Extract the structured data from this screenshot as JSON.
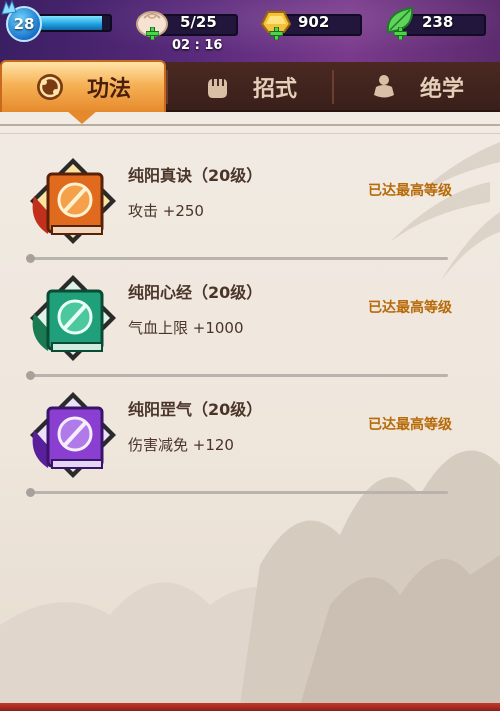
{
  "player": {
    "level": "28",
    "exp_fraction": 0.9
  },
  "resources": {
    "stamina": {
      "value": "5/25",
      "icon": "bun-icon"
    },
    "timer": "02 : 16",
    "gold": {
      "value": "902",
      "icon": "gold-ingot-icon"
    },
    "jade": {
      "value": "238",
      "icon": "jade-leaf-icon"
    }
  },
  "tabs": [
    {
      "label": "功法",
      "icon": "skill-orb-icon",
      "active": true
    },
    {
      "label": "招式",
      "icon": "fist-icon",
      "active": false
    },
    {
      "label": "绝学",
      "icon": "meditate-icon",
      "active": false
    }
  ],
  "skills": [
    {
      "name": "纯阳真诀（20级）",
      "effect": "攻击 +250",
      "status": "已达最高等级",
      "color": "#e06a1e",
      "icon": "red-skill-book-icon"
    },
    {
      "name": "纯阳心经（20级）",
      "effect": "气血上限 +1000",
      "status": "已达最高等级",
      "color": "#1fa07a",
      "icon": "green-skill-book-icon"
    },
    {
      "name": "纯阳罡气（20级）",
      "effect": "伤害减免 +120",
      "status": "已达最高等级",
      "color": "#8a3fd0",
      "icon": "purple-skill-book-icon"
    }
  ],
  "colors": {
    "status_text": "#b86a08",
    "tab_active": "#f6b256",
    "panel_bg": "#efe6dc"
  }
}
